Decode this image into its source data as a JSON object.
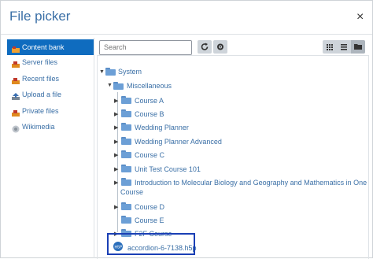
{
  "dialog": {
    "title": "File picker",
    "close_label": "×"
  },
  "sidebar": {
    "items": [
      {
        "label": "Content bank",
        "icon": "content-bank-icon",
        "active": true
      },
      {
        "label": "Server files",
        "icon": "server-files-icon"
      },
      {
        "label": "Recent files",
        "icon": "recent-files-icon"
      },
      {
        "label": "Upload a file",
        "icon": "upload-icon"
      },
      {
        "label": "Private files",
        "icon": "private-files-icon"
      },
      {
        "label": "Wikimedia",
        "icon": "wikimedia-icon"
      }
    ]
  },
  "toolbar": {
    "search_placeholder": "Search",
    "refresh_icon": "refresh-icon",
    "settings_icon": "gear-icon",
    "view_icons": [
      "grid-view-icon",
      "list-view-icon",
      "tree-view-icon"
    ]
  },
  "tree": {
    "root": "System",
    "category": "Miscellaneous",
    "courses": [
      "Course A",
      "Course B",
      "Wedding Planner",
      "Wedding Planner Advanced",
      "Course C",
      "Unit Test Course 101",
      "Introduction to Molecular Biology and Geography and Mathematics in One",
      "Course D",
      "Course E",
      "F2F Course"
    ],
    "course_continuation": "Course",
    "file": "accordion-6-7138.h5p"
  },
  "colors": {
    "accent": "#0f6cbf",
    "link": "#3a6fa6",
    "folder": "#6c9fd6",
    "highlight_border": "#1a3fb5"
  }
}
